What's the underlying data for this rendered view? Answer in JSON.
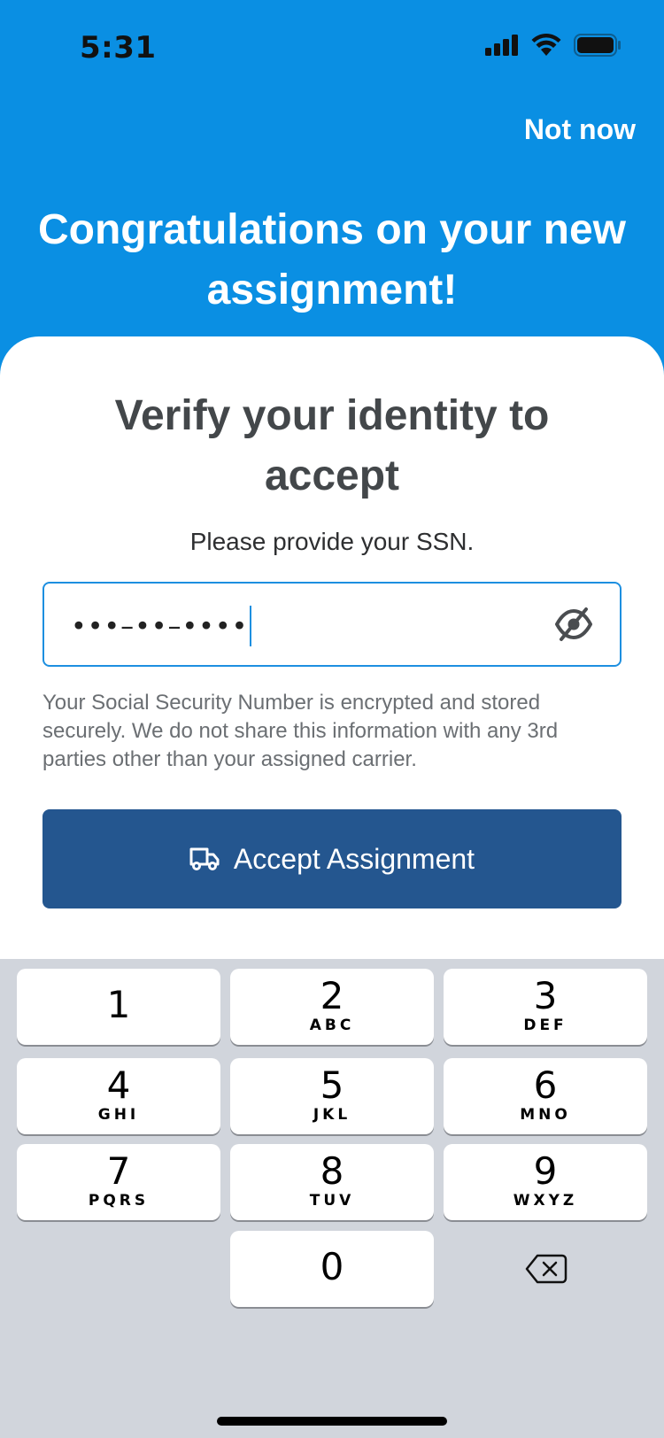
{
  "status_bar": {
    "time": "5:31"
  },
  "header": {
    "not_now_label": "Not now",
    "title": "Congratulations on your new assignment!"
  },
  "card": {
    "title": "Verify your identity to accept",
    "subtitle": "Please provide your SSN.",
    "ssn_field": {
      "value": "•••–••–••••"
    },
    "disclaimer": "Your Social Security Number is encrypted and stored securely. We do not share this information with any 3rd parties other than your assigned carrier.",
    "accept_label": "Accept Assignment"
  },
  "keyboard": {
    "keys": [
      {
        "num": "1",
        "letters": ""
      },
      {
        "num": "2",
        "letters": "ABC"
      },
      {
        "num": "3",
        "letters": "DEF"
      },
      {
        "num": "4",
        "letters": "GHI"
      },
      {
        "num": "5",
        "letters": "JKL"
      },
      {
        "num": "6",
        "letters": "MNO"
      },
      {
        "num": "7",
        "letters": "PQRS"
      },
      {
        "num": "8",
        "letters": "TUV"
      },
      {
        "num": "9",
        "letters": "WXYZ"
      },
      {
        "num": "0",
        "letters": ""
      }
    ]
  },
  "colors": {
    "header_bg": "#0a8fe3",
    "button_bg": "#24568f",
    "field_border": "#1d8fe0",
    "keyboard_bg": "#d1d5dc"
  },
  "icons": {
    "accept_button": "truck-icon",
    "ssn_field_toggle": "eye-off-icon",
    "keyboard_delete": "backspace-icon"
  }
}
